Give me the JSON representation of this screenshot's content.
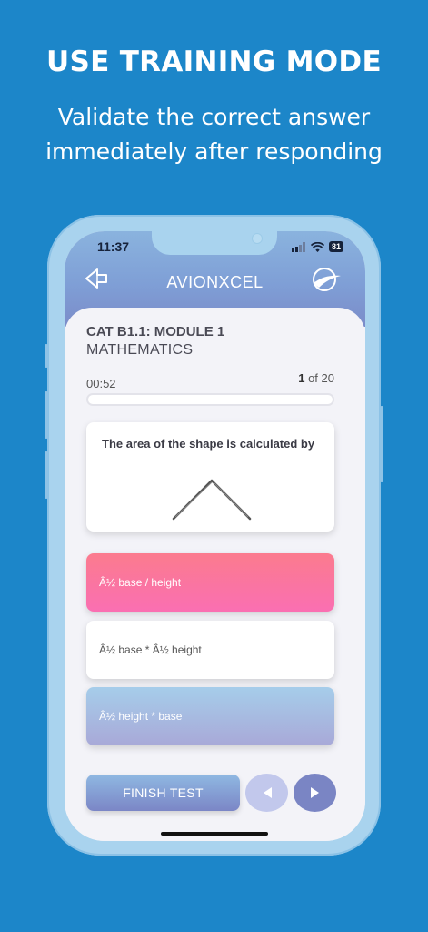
{
  "promo": {
    "title": "USE TRAINING MODE",
    "subtitle_line1": "Validate the correct answer",
    "subtitle_line2": "immediately after responding"
  },
  "status_bar": {
    "time": "11:37",
    "battery": "81",
    "icons": [
      "signal-icon",
      "wifi-icon",
      "battery-icon"
    ]
  },
  "header": {
    "title": "AVIONXCEL",
    "back_icon": "back-arrow-icon",
    "logo_icon": "avionxcel-logo-icon"
  },
  "quiz": {
    "module": "CAT B1.1: MODULE 1",
    "subject": "MATHEMATICS",
    "timer": "00:52",
    "current_question": "1",
    "of_label": "of 20",
    "progress": 0.0
  },
  "question": {
    "text": "The area of the shape is calculated by",
    "figure": "triangle-sketch"
  },
  "answers": [
    {
      "label": "Â½ base / height",
      "state": "wrong"
    },
    {
      "label": "Â½ base * Â½ height",
      "state": "neutral"
    },
    {
      "label": "Â½ height * base",
      "state": "correct"
    }
  ],
  "footer": {
    "finish_label": "FINISH TEST",
    "prev_icon": "chevron-left-icon",
    "next_icon": "chevron-right-icon"
  },
  "colors": {
    "background": "#1c86c9",
    "header_gradient_top": "#8ab3de",
    "header_gradient_bottom": "#7b8cc9",
    "wrong_answer": "#fb7b8e",
    "correct_answer": "#a6cdea"
  }
}
